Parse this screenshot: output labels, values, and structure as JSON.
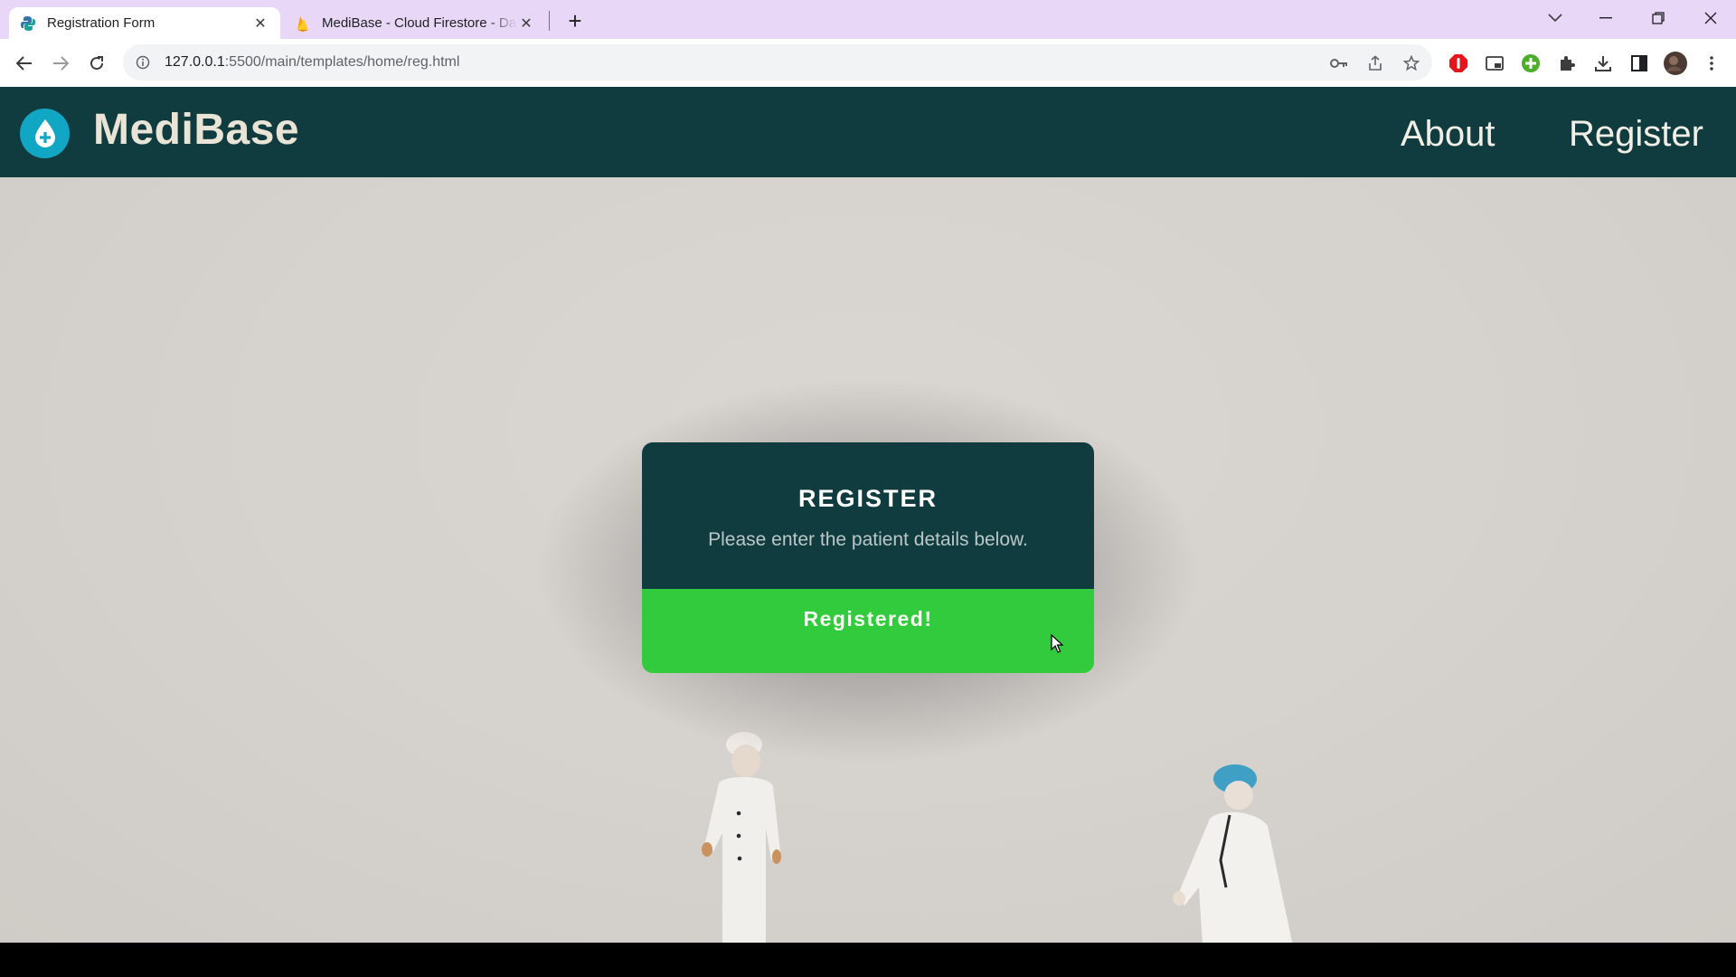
{
  "browser": {
    "tabs": [
      {
        "title": "Registration Form",
        "active": true,
        "favicon": "python-icon"
      },
      {
        "title": "MediBase - Cloud Firestore - Da",
        "active": false,
        "favicon": "firebase-icon"
      }
    ],
    "url_host": "127.0.0.1",
    "url_path": ":5500/main/templates/home/reg.html"
  },
  "site": {
    "brand": "MediBase",
    "nav": [
      {
        "label": "About"
      },
      {
        "label": "Register"
      }
    ]
  },
  "card": {
    "title": "REGISTER",
    "subtitle": "Please enter the patient details below.",
    "button_label": "Registered!"
  },
  "colors": {
    "header_bg": "#113c3f",
    "accent_green": "#33cb3e",
    "logo_blue": "#11a7c4"
  }
}
